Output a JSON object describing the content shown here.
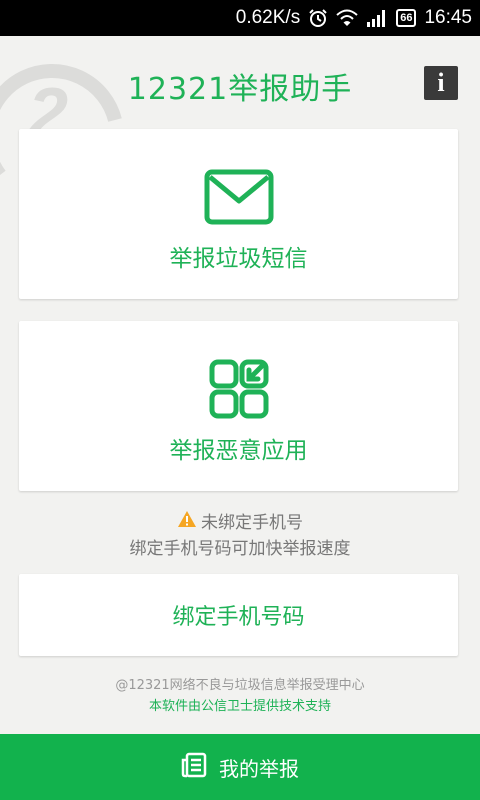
{
  "statusbar": {
    "speed": "0.62K/s",
    "battery": "66",
    "time": "16:45",
    "icons": [
      "alarm-icon",
      "wifi-icon",
      "signal-icon",
      "battery-icon"
    ]
  },
  "header": {
    "title": "12321举报助手",
    "info_icon": "i"
  },
  "cards": {
    "sms": {
      "label": "举报垃圾短信",
      "icon": "envelope-icon"
    },
    "app": {
      "label": "举报恶意应用",
      "icon": "app-grid-icon"
    }
  },
  "notice": {
    "line1": "未绑定手机号",
    "line2": "绑定手机号码可加快举报速度",
    "icon": "warning-icon"
  },
  "bind": {
    "label": "绑定手机号码"
  },
  "footer": {
    "copyright": "@12321网络不良与垃圾信息举报受理中心",
    "credit": "本软件由公信卫士提供技术支持"
  },
  "bottom_bar": {
    "label": "我的举报",
    "icon": "document-list-icon"
  },
  "colors": {
    "accent": "#1fb257",
    "bottom_bar": "#12b24d",
    "warning": "#f5a623",
    "background": "#f2f2f0"
  }
}
